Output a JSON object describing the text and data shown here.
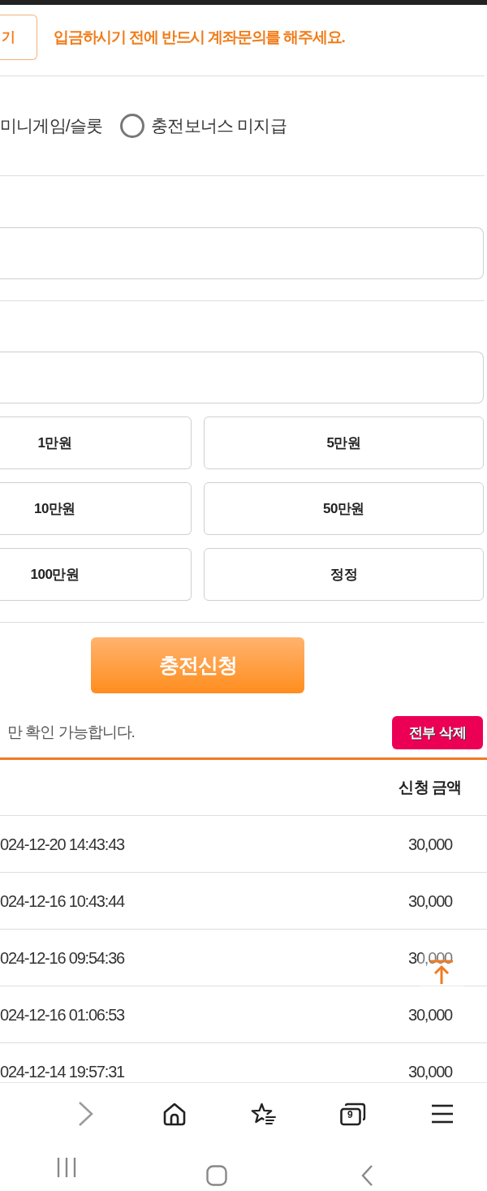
{
  "top_bar": {
    "button_label": "기",
    "notice": "입금하시기 전에 반드시 계좌문의를 해주세요."
  },
  "bonus_options": [
    {
      "label": "미니게임/슬롯"
    },
    {
      "label": "충전보너스 미지급",
      "selected": false
    }
  ],
  "input_fields": [
    {
      "kind": "text"
    },
    {
      "kind": "text"
    }
  ],
  "amount_buttons": [
    "1만원",
    "5만원",
    "10만원",
    "50만원",
    "100만원",
    "정정"
  ],
  "submit_button": "충전신청",
  "history": {
    "info_text": "만 확인 가능합니다.",
    "delete_all_button": "전부 삭제"
  },
  "table": {
    "amount_header": "신청 금액",
    "rows": [
      {
        "column_1": "024-12-20 14:43:43",
        "amount": "30,000"
      },
      {
        "column_1": "024-12-16 10:43:44",
        "amount": "30,000"
      },
      {
        "column_1": "024-12-16 09:54:36",
        "amount": "30,000"
      },
      {
        "column_1": "024-12-16 01:06:53",
        "amount": "30,000"
      },
      {
        "column_1": "024-12-14 19:57:31",
        "amount": "30,000"
      }
    ]
  },
  "browser_toolbar": {
    "tab_count": "9"
  }
}
